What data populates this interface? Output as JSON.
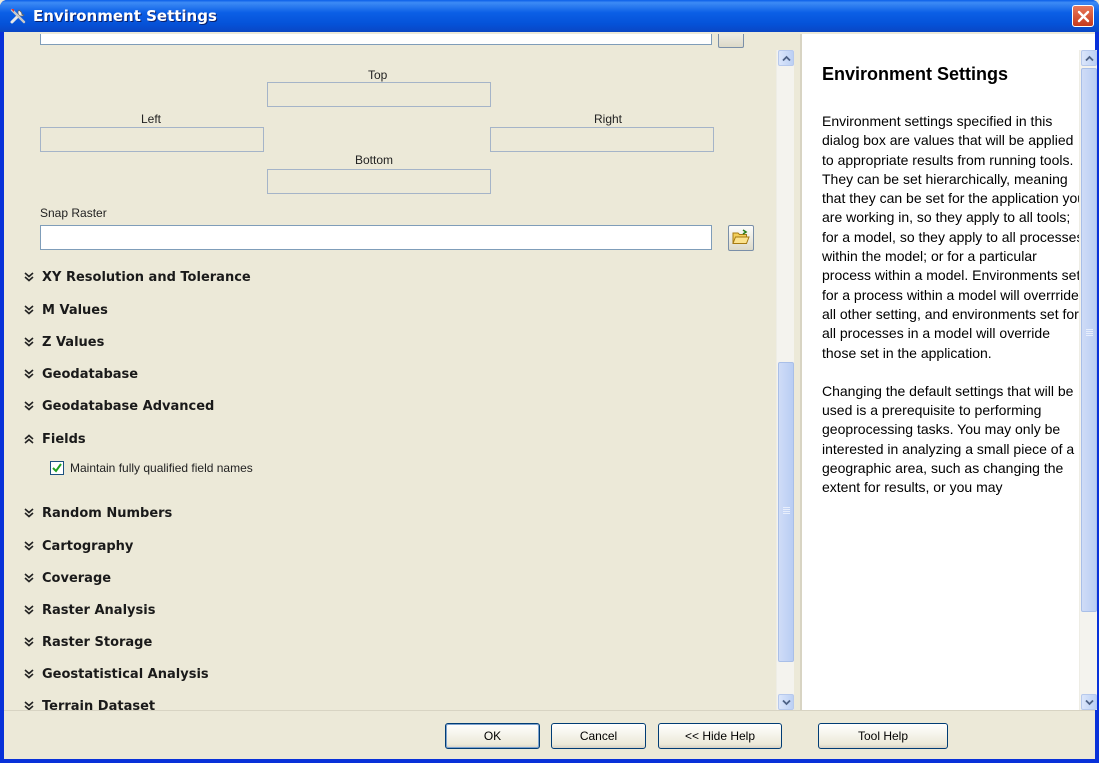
{
  "window": {
    "title": "Environment Settings",
    "title_icon": "tools-icon",
    "close_icon": "close-icon"
  },
  "extent": {
    "top_label": "Top",
    "left_label": "Left",
    "right_label": "Right",
    "bottom_label": "Bottom"
  },
  "snap_raster": {
    "label": "Snap Raster",
    "value": "",
    "browse_icon": "folder-open-icon"
  },
  "sections": [
    {
      "label": "XY Resolution and Tolerance",
      "state": "collapsed"
    },
    {
      "label": "M Values",
      "state": "collapsed"
    },
    {
      "label": "Z Values",
      "state": "collapsed"
    },
    {
      "label": "Geodatabase",
      "state": "collapsed"
    },
    {
      "label": "Geodatabase Advanced",
      "state": "collapsed"
    },
    {
      "label": "Fields",
      "state": "expanded"
    },
    {
      "label": "Random Numbers",
      "state": "collapsed"
    },
    {
      "label": "Cartography",
      "state": "collapsed"
    },
    {
      "label": "Coverage",
      "state": "collapsed"
    },
    {
      "label": "Raster Analysis",
      "state": "collapsed"
    },
    {
      "label": "Raster Storage",
      "state": "collapsed"
    },
    {
      "label": "Geostatistical Analysis",
      "state": "collapsed"
    },
    {
      "label": "Terrain Dataset",
      "state": "collapsed"
    }
  ],
  "fields": {
    "checkbox_label": "Maintain fully qualified field names",
    "checked": true
  },
  "help": {
    "title": "Environment Settings",
    "paragraph1": "Environment settings specified in this dialog box are values that will be applied to appropriate results from running tools. They can be set hierarchically, meaning that they can be set for the application you are working in, so they apply to all tools; for a model, so they apply to all processes within the model; or for a particular process within a model. Environments set for a process within a model will overrride all other setting, and environments set for all processes in a model will override those set in the application.",
    "paragraph2": "Changing the default settings that will be used is a prerequisite to performing geoprocessing tasks. You may only be interested in analyzing a small piece of a geographic area, such as changing the extent for results, or you may"
  },
  "buttons": {
    "ok": "OK",
    "cancel": "Cancel",
    "hide_help": "<< Hide Help",
    "tool_help": "Tool Help"
  },
  "colors": {
    "titlebar": "#0b5fe6",
    "dialog_bg": "#ece9d8",
    "close_button": "#d5502f"
  }
}
